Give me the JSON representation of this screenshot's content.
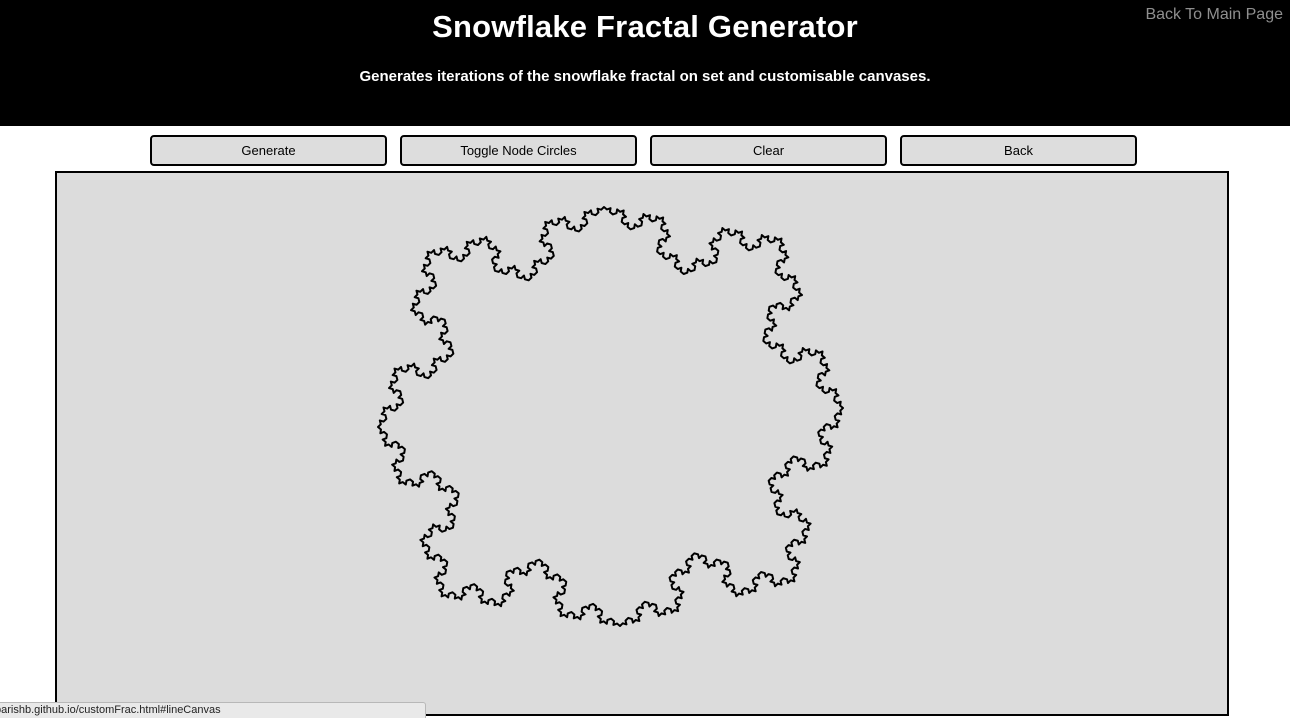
{
  "header": {
    "title": "Snowflake Fractal Generator",
    "subtitle": "Generates iterations of the snowflake fractal on set and customisable canvases.",
    "main_page_link": "Back To Main Page"
  },
  "toolbar": {
    "generate_label": "Generate",
    "toggle_nodes_label": "Toggle Node Circles",
    "clear_label": "Clear",
    "back_label": "Back"
  },
  "canvas": {
    "fractal_iterations": 4,
    "background_color": "#dcdcdc",
    "stroke_color": "#000000"
  },
  "status_bar": {
    "url": "parishb.github.io/customFrac.html#lineCanvas"
  }
}
